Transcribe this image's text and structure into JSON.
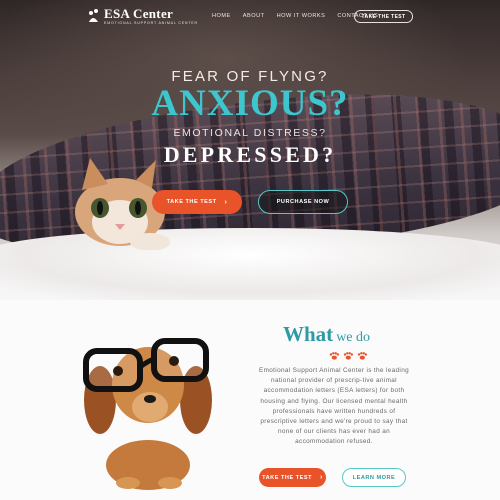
{
  "brand": {
    "title": "ESA Center",
    "subtitle": "EMOTIONAL SUPPORT ANIMAL CENTER"
  },
  "nav": {
    "items": [
      {
        "label": "HOME"
      },
      {
        "label": "ABOUT"
      },
      {
        "label": "HOW IT WORKS"
      },
      {
        "label": "CONTACT US"
      }
    ],
    "cta_label": "TAKE THE TEST"
  },
  "hero": {
    "line1": "FEAR OF FLYNG?",
    "line2": "ANXIOUS?",
    "line3": "EMOTIONAL DISTRESS?",
    "line4": "DEPRESSED?",
    "primary_button": "TAKE THE TEST",
    "secondary_button": "PURCHASE NOW"
  },
  "what_we_do": {
    "heading_bold": "What",
    "heading_rest": "we do",
    "description": "Emotional Support Animal Center is the leading national provider of prescrip-tive animal accommodation letters (ESA letters) for both housing and flying. Our licensed mental health professionals have written hundreds of prescriptive letters and we're proud to say that none of our clients has ever had an accommodation refused.",
    "primary_button": "TAKE THE TEST",
    "secondary_button": "LEARN MORE"
  },
  "colors": {
    "accent_teal": "#3ec6cf",
    "accent_orange": "#e8532a",
    "heading_teal": "#2d9aa6"
  },
  "icons": [
    "paw-logo-icon",
    "chevron-right-icon",
    "paw-print-icon"
  ]
}
